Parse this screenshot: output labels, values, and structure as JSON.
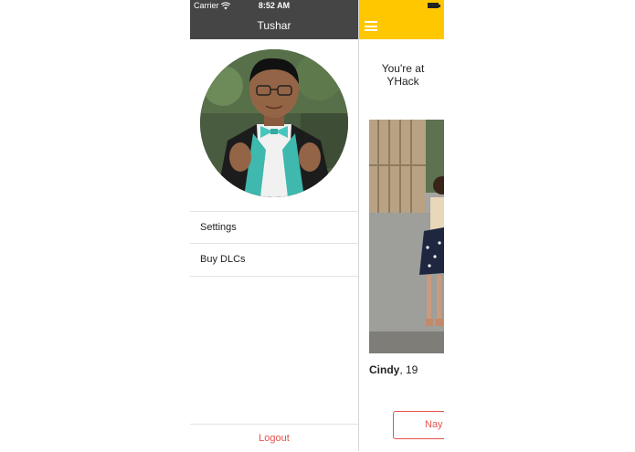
{
  "status_bar": {
    "carrier": "Carrier",
    "time": "8:52 AM"
  },
  "drawer": {
    "username": "Tushar",
    "avatar_icon": "user-photo",
    "menu": [
      {
        "label": "Settings"
      },
      {
        "label": "Buy DLCs"
      }
    ],
    "logout_label": "Logout"
  },
  "main": {
    "nav_icon": "hamburger-icon",
    "location_line1": "You're at",
    "location_line2": "YHack",
    "profile": {
      "name": "Cindy",
      "age_text": ", 19"
    },
    "nay_label": "Nay"
  },
  "colors": {
    "accent_yellow": "#ffc700",
    "header_dark": "#454545",
    "danger_red": "#e4534b"
  }
}
